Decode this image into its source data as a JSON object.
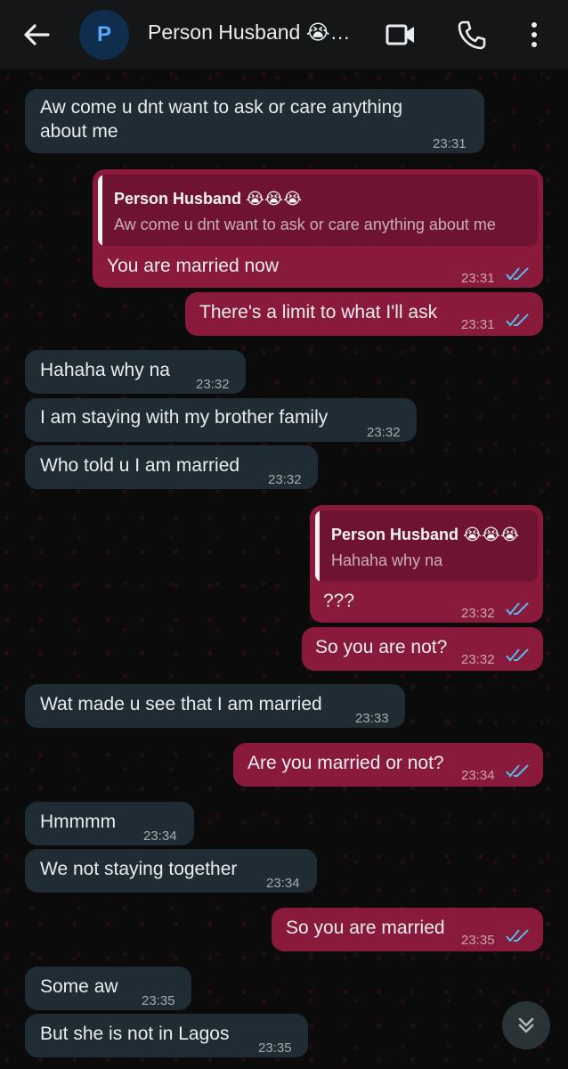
{
  "header": {
    "avatar_letter": "P",
    "title": "Person Husband 😭…"
  },
  "messages": [
    {
      "text_l1": "Aw come u dnt want to ask or care anything",
      "text_l2": "about me",
      "time": "23:31"
    },
    {
      "quote_name": "Person Husband 😭😭😭",
      "quote_text": "Aw come u dnt want to ask or care anything about me",
      "text": "You are married now",
      "time": "23:31"
    },
    {
      "text": "There's a limit to what I'll ask",
      "time": "23:31"
    },
    {
      "text": "Hahaha why na",
      "time": "23:32"
    },
    {
      "text": "I am staying with my brother family",
      "time": "23:32"
    },
    {
      "text": "Who told u I am married",
      "time": "23:32"
    },
    {
      "quote_name": "Person Husband 😭😭😭",
      "quote_text": "Hahaha why na",
      "text": "???",
      "time": "23:32"
    },
    {
      "text": "So you are not?",
      "time": "23:32"
    },
    {
      "text": "Wat made u see that I am married",
      "time": "23:33"
    },
    {
      "text": "Are you married or not?",
      "time": "23:34"
    },
    {
      "text": "Hmmmm",
      "time": "23:34"
    },
    {
      "text": "We not staying together",
      "time": "23:34"
    },
    {
      "text": "So you are married",
      "time": "23:35"
    },
    {
      "text": "Some aw",
      "time": "23:35"
    },
    {
      "text": "But she is not in Lagos",
      "time": "23:35"
    }
  ],
  "colors": {
    "incoming_bubble": "#202c33",
    "outgoing_bubble": "#8a1a3c",
    "read_ticks": "#53bdeb"
  }
}
